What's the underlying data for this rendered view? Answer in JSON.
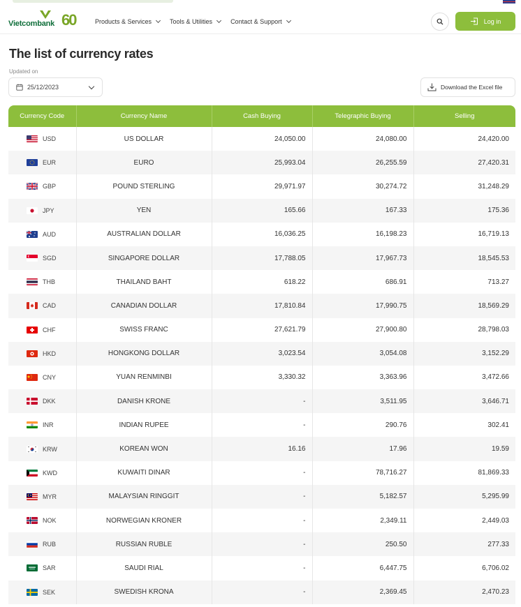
{
  "brand": {
    "name": "Vietcombank",
    "anniversary": "60"
  },
  "nav": {
    "items": [
      {
        "label": "Products & Services"
      },
      {
        "label": "Tools & Utilities"
      },
      {
        "label": "Contact & Support"
      }
    ],
    "login_label": "Log in"
  },
  "page": {
    "title": "The list of currency rates",
    "updated_label": "Updated on",
    "date_value": "25/12/2023",
    "download_label": "Download the Excel file"
  },
  "table": {
    "headers": [
      "Currency Code",
      "Currency Name",
      "Cash Buying",
      "Telegraphic Buying",
      "Selling"
    ],
    "rows": [
      {
        "code": "USD",
        "name": "US DOLLAR",
        "cash": "24,050.00",
        "transfer": "24,080.00",
        "sell": "24,420.00"
      },
      {
        "code": "EUR",
        "name": "EURO",
        "cash": "25,993.04",
        "transfer": "26,255.59",
        "sell": "27,420.31"
      },
      {
        "code": "GBP",
        "name": "POUND STERLING",
        "cash": "29,971.97",
        "transfer": "30,274.72",
        "sell": "31,248.29"
      },
      {
        "code": "JPY",
        "name": "YEN",
        "cash": "165.66",
        "transfer": "167.33",
        "sell": "175.36"
      },
      {
        "code": "AUD",
        "name": "AUSTRALIAN DOLLAR",
        "cash": "16,036.25",
        "transfer": "16,198.23",
        "sell": "16,719.13"
      },
      {
        "code": "SGD",
        "name": "SINGAPORE DOLLAR",
        "cash": "17,788.05",
        "transfer": "17,967.73",
        "sell": "18,545.53"
      },
      {
        "code": "THB",
        "name": "THAILAND BAHT",
        "cash": "618.22",
        "transfer": "686.91",
        "sell": "713.27"
      },
      {
        "code": "CAD",
        "name": "CANADIAN DOLLAR",
        "cash": "17,810.84",
        "transfer": "17,990.75",
        "sell": "18,569.29"
      },
      {
        "code": "CHF",
        "name": "SWISS FRANC",
        "cash": "27,621.79",
        "transfer": "27,900.80",
        "sell": "28,798.03"
      },
      {
        "code": "HKD",
        "name": "HONGKONG DOLLAR",
        "cash": "3,023.54",
        "transfer": "3,054.08",
        "sell": "3,152.29"
      },
      {
        "code": "CNY",
        "name": "YUAN RENMINBI",
        "cash": "3,330.32",
        "transfer": "3,363.96",
        "sell": "3,472.66"
      },
      {
        "code": "DKK",
        "name": "DANISH KRONE",
        "cash": "-",
        "transfer": "3,511.95",
        "sell": "3,646.71"
      },
      {
        "code": "INR",
        "name": "INDIAN RUPEE",
        "cash": "-",
        "transfer": "290.76",
        "sell": "302.41"
      },
      {
        "code": "KRW",
        "name": "KOREAN WON",
        "cash": "16.16",
        "transfer": "17.96",
        "sell": "19.59"
      },
      {
        "code": "KWD",
        "name": "KUWAITI DINAR",
        "cash": "-",
        "transfer": "78,716.27",
        "sell": "81,869.33"
      },
      {
        "code": "MYR",
        "name": "MALAYSIAN RINGGIT",
        "cash": "-",
        "transfer": "5,182.57",
        "sell": "5,295.99"
      },
      {
        "code": "NOK",
        "name": "NORWEGIAN KRONER",
        "cash": "-",
        "transfer": "2,349.11",
        "sell": "2,449.03"
      },
      {
        "code": "RUB",
        "name": "RUSSIAN RUBLE",
        "cash": "-",
        "transfer": "250.50",
        "sell": "277.33"
      },
      {
        "code": "SAR",
        "name": "SAUDI RIAL",
        "cash": "-",
        "transfer": "6,447.75",
        "sell": "6,706.02"
      },
      {
        "code": "SEK",
        "name": "SWEDISH KRONA",
        "cash": "-",
        "transfer": "2,369.45",
        "sell": "2,470.23"
      }
    ]
  },
  "colors": {
    "accent": "#8dbe3c",
    "brand_green": "#0f6e3a",
    "row_alt": "#f5f5f5"
  },
  "icons": {
    "search": "search-icon",
    "login": "login-icon",
    "calendar": "calendar-icon",
    "download": "download-icon",
    "dropdown": "chevron-down-icon"
  }
}
